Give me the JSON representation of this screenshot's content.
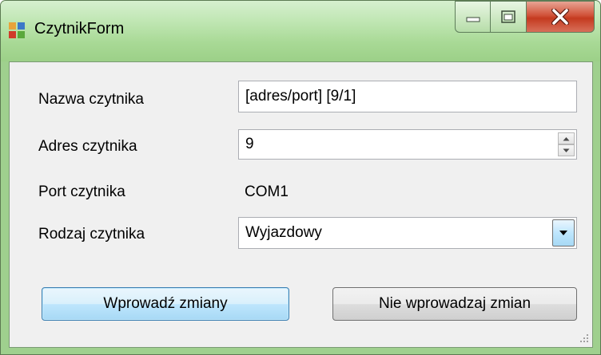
{
  "window": {
    "title": "CzytnikForm"
  },
  "form": {
    "name_label": "Nazwa czytnika",
    "name_value": "[adres/port] [9/1]",
    "address_label": "Adres czytnika",
    "address_value": "9",
    "port_label": "Port czytnika",
    "port_value": "COM1",
    "type_label": "Rodzaj czytnika",
    "type_value": "Wyjazdowy"
  },
  "buttons": {
    "apply": "Wprowadź zmiany",
    "cancel": "Nie wprowadzaj zmian"
  },
  "icons": {
    "app": "app-window-icon",
    "minimize": "minimize-icon",
    "maximize": "maximize-icon",
    "close": "close-icon",
    "spin_up": "spin-up-icon",
    "spin_down": "spin-down-icon",
    "dropdown": "dropdown-arrow-icon"
  },
  "colors": {
    "titlebar": "#a8d995",
    "close_button": "#c43a1f",
    "client_background": "#f0f0f0"
  }
}
